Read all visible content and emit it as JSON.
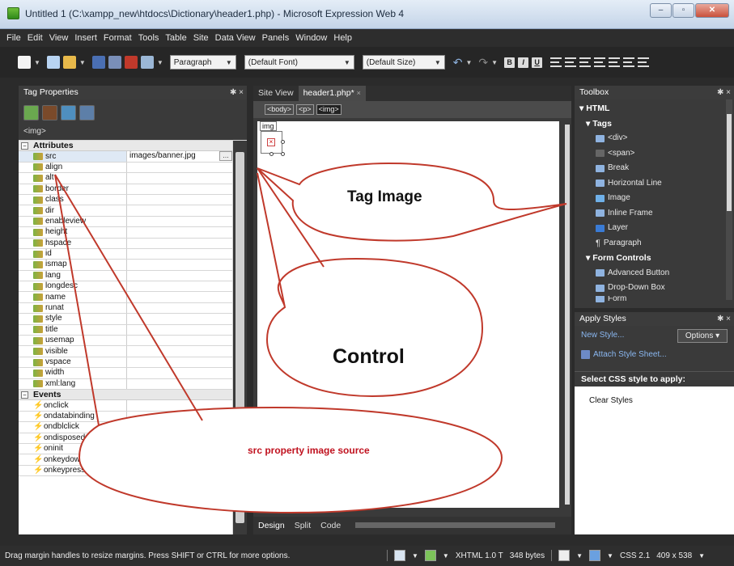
{
  "window": {
    "title": "Untitled 1 (C:\\xampp_new\\htdocs\\Dictionary\\header1.php) - Microsoft Expression Web 4",
    "minimize": "–",
    "maximize": "▫",
    "close": "✕"
  },
  "menu": [
    "File",
    "Edit",
    "View",
    "Insert",
    "Format",
    "Tools",
    "Table",
    "Site",
    "Data View",
    "Panels",
    "Window",
    "Help"
  ],
  "toolbar": {
    "style_select": "Paragraph",
    "font_select": "(Default Font)",
    "size_select": "(Default Size)",
    "format_buttons": [
      "B",
      "I",
      "U"
    ]
  },
  "tag_properties": {
    "title": "Tag Properties",
    "pin": "✱ ×",
    "current_tag": "<img>",
    "attributes_header": "Attributes",
    "attributes": [
      {
        "name": "src",
        "value": "images/banner.jpg"
      },
      {
        "name": "align",
        "value": ""
      },
      {
        "name": "alt",
        "value": ""
      },
      {
        "name": "border",
        "value": ""
      },
      {
        "name": "class",
        "value": ""
      },
      {
        "name": "dir",
        "value": ""
      },
      {
        "name": "enableview",
        "value": ""
      },
      {
        "name": "height",
        "value": ""
      },
      {
        "name": "hspace",
        "value": ""
      },
      {
        "name": "id",
        "value": ""
      },
      {
        "name": "ismap",
        "value": ""
      },
      {
        "name": "lang",
        "value": ""
      },
      {
        "name": "longdesc",
        "value": ""
      },
      {
        "name": "name",
        "value": ""
      },
      {
        "name": "runat",
        "value": ""
      },
      {
        "name": "style",
        "value": ""
      },
      {
        "name": "title",
        "value": ""
      },
      {
        "name": "usemap",
        "value": ""
      },
      {
        "name": "visible",
        "value": ""
      },
      {
        "name": "vspace",
        "value": ""
      },
      {
        "name": "width",
        "value": ""
      },
      {
        "name": "xml:lang",
        "value": ""
      }
    ],
    "events_header": "Events",
    "events": [
      "onclick",
      "ondatabinding",
      "ondblclick",
      "ondisposed",
      "oninit",
      "onkeydown",
      "onkeypress"
    ]
  },
  "editor": {
    "tabs": [
      "Site View",
      "header1.php*"
    ],
    "breadcrumbs": [
      "<body>",
      "<p>",
      "<img>"
    ],
    "img_chip": "img",
    "view_tabs": [
      "Design",
      "Split",
      "Code"
    ]
  },
  "toolbox": {
    "title": "Toolbox",
    "pin": "✱ ×",
    "html_header": "HTML",
    "tags_header": "Tags",
    "tags": [
      "<div>",
      "<span>",
      "Break",
      "Horizontal Line",
      "Image",
      "Inline Frame",
      "Layer",
      "Paragraph"
    ],
    "form_header": "Form Controls",
    "form_items": [
      "Advanced Button",
      "Drop-Down Box",
      "Form"
    ]
  },
  "apply_styles": {
    "title": "Apply Styles",
    "pin": "✱ ×",
    "new_style": "New Style...",
    "options": "Options ▾",
    "attach": "Attach Style Sheet...",
    "select_label": "Select CSS style to apply:",
    "clear": "Clear Styles"
  },
  "status": {
    "message": "Drag margin handles to resize margins. Press SHIFT or CTRL for more options.",
    "doctype": "XHTML 1.0 T",
    "size": "348 bytes",
    "css": "CSS 2.1",
    "dimensions": "409 x 538"
  },
  "annotations": {
    "tag_image": "Tag Image",
    "control": "Control",
    "src_note": "src property image source"
  }
}
